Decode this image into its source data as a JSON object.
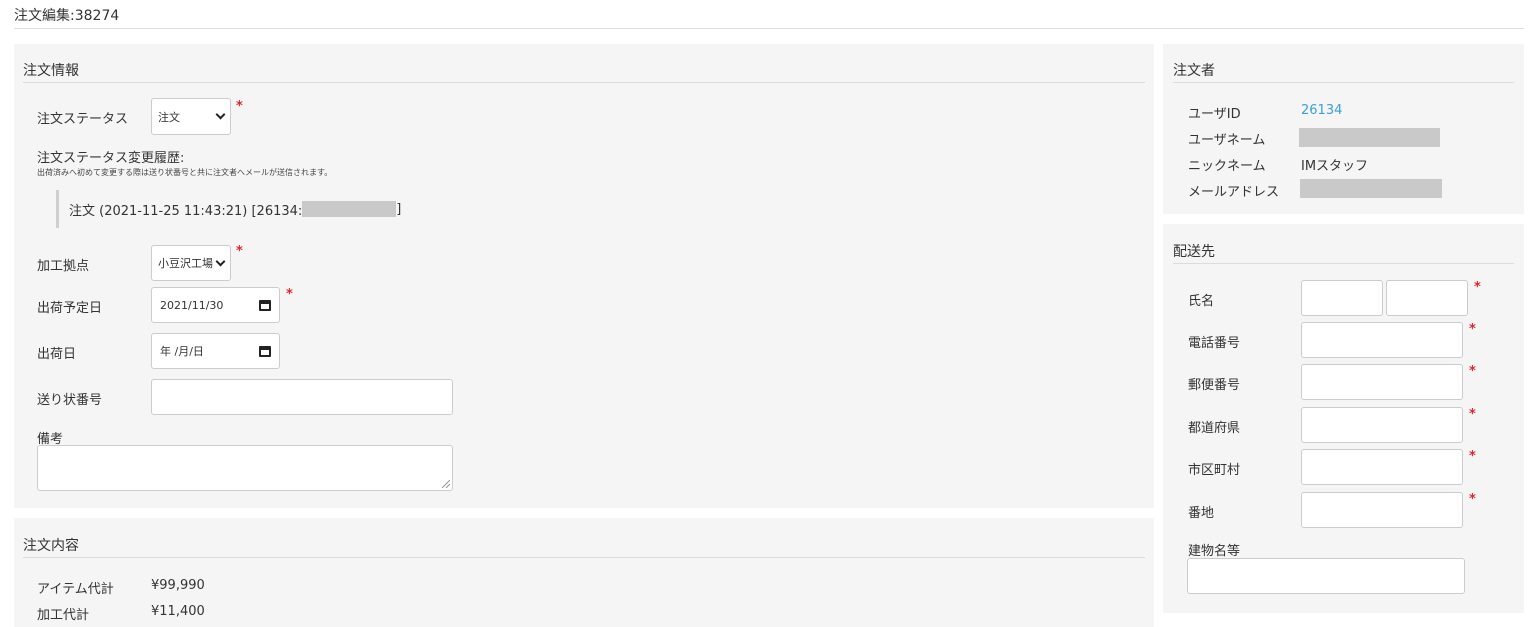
{
  "page": {
    "title": "注文編集:38274"
  },
  "order_info": {
    "heading": "注文情報",
    "status": {
      "label": "注文ステータス",
      "value": "注文",
      "required": "*"
    },
    "history": {
      "label": "注文ステータス変更履歴:",
      "note": "出荷済みへ初めて変更する際は送り状番号と共に注文者へメールが送信されます。",
      "entry_prefix": "注文 (2021-11-25 11:43:21) [26134:",
      "entry_suffix": "]"
    },
    "factory": {
      "label": "加工拠点",
      "value": "小豆沢工場",
      "required": "*"
    },
    "scheduled_ship_date": {
      "label": "出荷予定日",
      "value": "2021/11/30",
      "required": "*"
    },
    "ship_date": {
      "label": "出荷日",
      "placeholder": "年 /月/日"
    },
    "tracking_number": {
      "label": "送り状番号",
      "value": ""
    },
    "remarks": {
      "label": "備考",
      "value": ""
    }
  },
  "order_content": {
    "heading": "注文内容",
    "rows": [
      {
        "label": "アイテム代計",
        "value": "¥99,990"
      },
      {
        "label": "加工代計",
        "value": "¥11,400"
      }
    ]
  },
  "orderer": {
    "heading": "注文者",
    "user_id_label": "ユーザID",
    "user_id": "26134",
    "username_label": "ユーザネーム",
    "nickname_label": "ニックネーム",
    "nickname": "IMスタッフ",
    "email_label": "メールアドレス"
  },
  "shipping": {
    "heading": "配送先",
    "required": "*",
    "fields": {
      "name": "氏名",
      "phone": "電話番号",
      "postal": "郵便番号",
      "prefecture": "都道府県",
      "city": "市区町村",
      "street": "番地",
      "building": "建物名等"
    }
  },
  "colors": {
    "required": "#e0242c",
    "link": "#3aa0d8",
    "panel": "#f5f5f5"
  },
  "icons": [
    "chevron-down-icon",
    "calendar-icon",
    "resize-handle-icon"
  ]
}
